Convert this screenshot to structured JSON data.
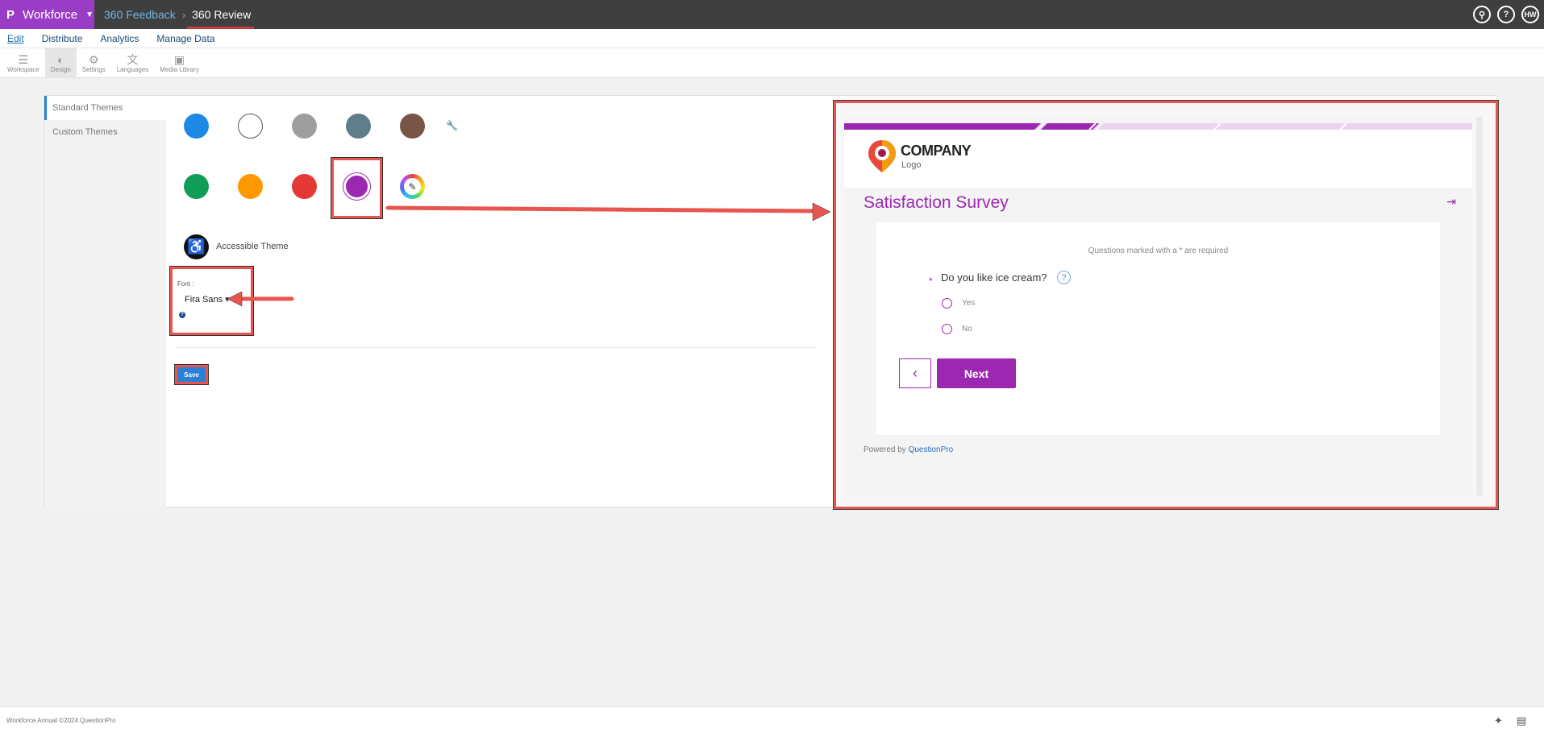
{
  "topbar": {
    "brand_logo": "P",
    "brand_label": "Workforce",
    "breadcrumb": [
      "360 Feedback",
      "360 Review"
    ],
    "icons": [
      "search-icon",
      "help-icon",
      "user-avatar"
    ],
    "avatar_initials": "HW"
  },
  "menu": {
    "items": [
      "Edit",
      "Distribute",
      "Analytics",
      "Manage Data"
    ],
    "active": "Edit"
  },
  "toolbar": {
    "items": [
      {
        "label": "Workspace",
        "icon": "workspace-icon"
      },
      {
        "label": "Design",
        "icon": "palette-icon",
        "active": true
      },
      {
        "label": "Settings",
        "icon": "gear-icon"
      },
      {
        "label": "Languages",
        "icon": "languages-icon"
      },
      {
        "label": "Media Library",
        "icon": "image-icon"
      }
    ]
  },
  "sidenav": {
    "items": [
      "Standard Themes",
      "Custom Themes"
    ],
    "active": "Standard Themes"
  },
  "themes": {
    "row1_colors": [
      "#1e88e5",
      "#ffffff",
      "#9e9e9e",
      "#607d8b",
      "#795548"
    ],
    "row2_colors": [
      "#0f9d58",
      "#ff9800",
      "#e53935",
      "#9c27b0"
    ],
    "selected": "#9c27b0",
    "accessible_label": "Accessible Theme"
  },
  "font": {
    "label": "Font :",
    "value": "Fira Sans",
    "caret": "▾",
    "help": "?"
  },
  "save_label": "Save",
  "preview": {
    "accent": "#9c28b1",
    "logo_title": "COMPANY",
    "logo_sub": "Logo",
    "survey_title": "Satisfaction Survey",
    "required_note": "Questions marked with a * are required",
    "question": "Do you like ice cream?",
    "question_star": "*",
    "options": [
      "Yes",
      "No"
    ],
    "back_symbol": "‹",
    "next_label": "Next",
    "powered_prefix": "Powered by",
    "powered_link": "QuestionPro"
  },
  "footer": {
    "text": "Workforce Annual ©2024 QuestionPro"
  }
}
